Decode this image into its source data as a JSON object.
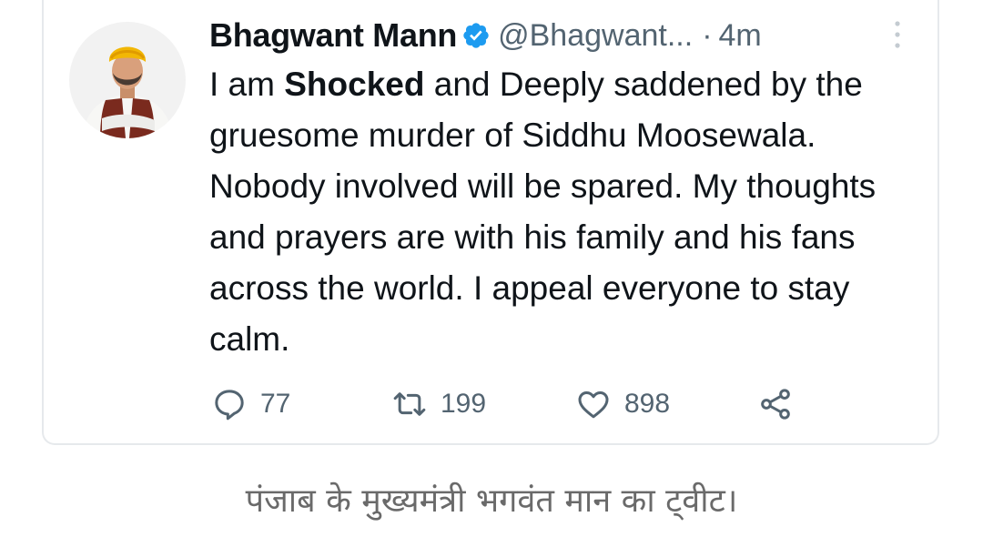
{
  "tweet": {
    "author": {
      "display_name": "Bhagwant Mann",
      "handle": "@Bhagwant...",
      "verified": true,
      "avatar_icon": "profile-photo"
    },
    "separator": "·",
    "timestamp": "4m",
    "text": {
      "part1": "I am ",
      "bold": "Shocked",
      "part2": " and Deeply saddened by the gruesome murder of Siddhu Moosewala. Nobody involved will be spared. My thoughts and prayers are with his family and his fans across the world. I appeal everyone to stay calm."
    },
    "stats": {
      "replies": "77",
      "retweets": "199",
      "likes": "898"
    },
    "icons": {
      "reply": "reply-icon",
      "retweet": "retweet-icon",
      "like": "heart-icon",
      "share": "share-icon",
      "more": "more-options-icon",
      "verified": "verified-badge-icon"
    },
    "colors": {
      "verified_blue": "#1d9bf0",
      "text_primary": "#0f1419",
      "text_secondary": "#536471"
    }
  },
  "caption": "पंजाब के मुख्यमंत्री भगवंत मान का ट्वीट।"
}
